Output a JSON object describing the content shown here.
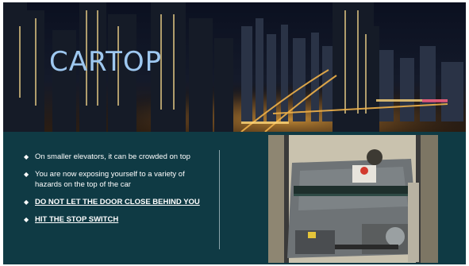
{
  "slide": {
    "title": "CARTOP",
    "bullets": [
      {
        "text": "On smaller elevators, it can be crowded on top",
        "emphasis": false
      },
      {
        "text": "You are now exposing yourself to a variety of hazards on the top of the car",
        "emphasis": false
      },
      {
        "text": "DO NOT LET THE DOOR CLOSE BEHIND YOU",
        "emphasis": true
      },
      {
        "text": "HIT THE STOP SWITCH",
        "emphasis": true
      }
    ],
    "bullet_icon": "diamond-bullet-icon",
    "colors": {
      "title": "#9ec8f0",
      "content_background": "#0f3a44",
      "text": "#ffffff"
    }
  }
}
